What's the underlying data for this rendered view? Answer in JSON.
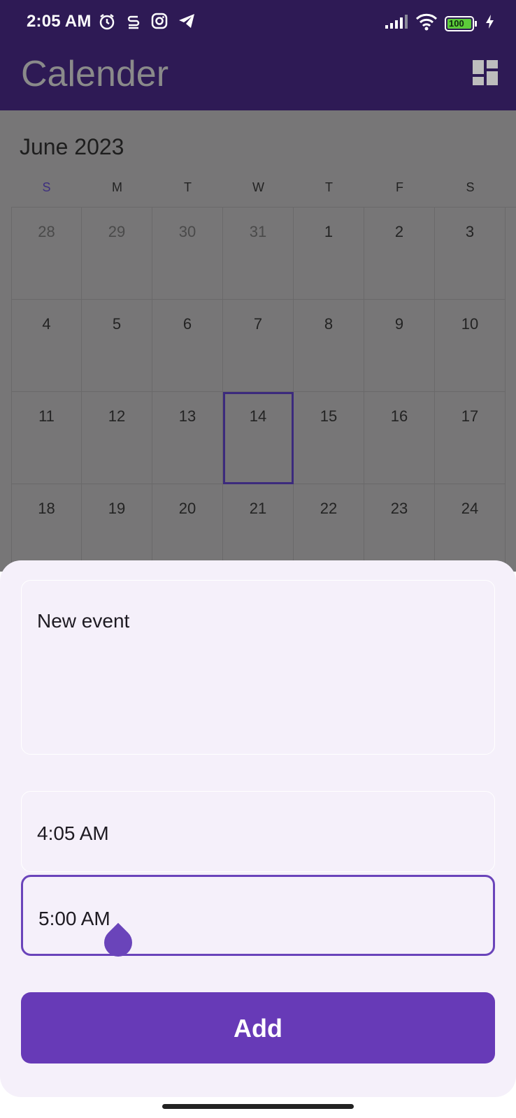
{
  "status_bar": {
    "time": "2:05 AM",
    "battery": "100",
    "icons_left": [
      "alarm-icon",
      "s-logo-icon",
      "instagram-icon",
      "telegram-icon"
    ],
    "icons_right": [
      "signal-icon",
      "wifi-icon",
      "battery-icon",
      "charging-icon"
    ]
  },
  "app_bar": {
    "title": "Calender",
    "action_icon": "dashboard-icon"
  },
  "calendar": {
    "month": "June 2023",
    "weekdays": [
      "S",
      "M",
      "T",
      "W",
      "T",
      "F",
      "S"
    ],
    "weeks": [
      [
        "28",
        "29",
        "30",
        "31",
        "1",
        "2",
        "3"
      ],
      [
        "4",
        "5",
        "6",
        "7",
        "8",
        "9",
        "10"
      ],
      [
        "11",
        "12",
        "13",
        "14",
        "15",
        "16",
        "17"
      ],
      [
        "18",
        "19",
        "20",
        "21",
        "22",
        "23",
        "24"
      ]
    ],
    "selected_day": "14",
    "selected_color": "#3c2a7d"
  },
  "sheet": {
    "event_title_value": "New event",
    "start_time": "4:05 AM",
    "end_time": "5:00 AM",
    "add_label": "Add",
    "accent": "#673ab7"
  }
}
